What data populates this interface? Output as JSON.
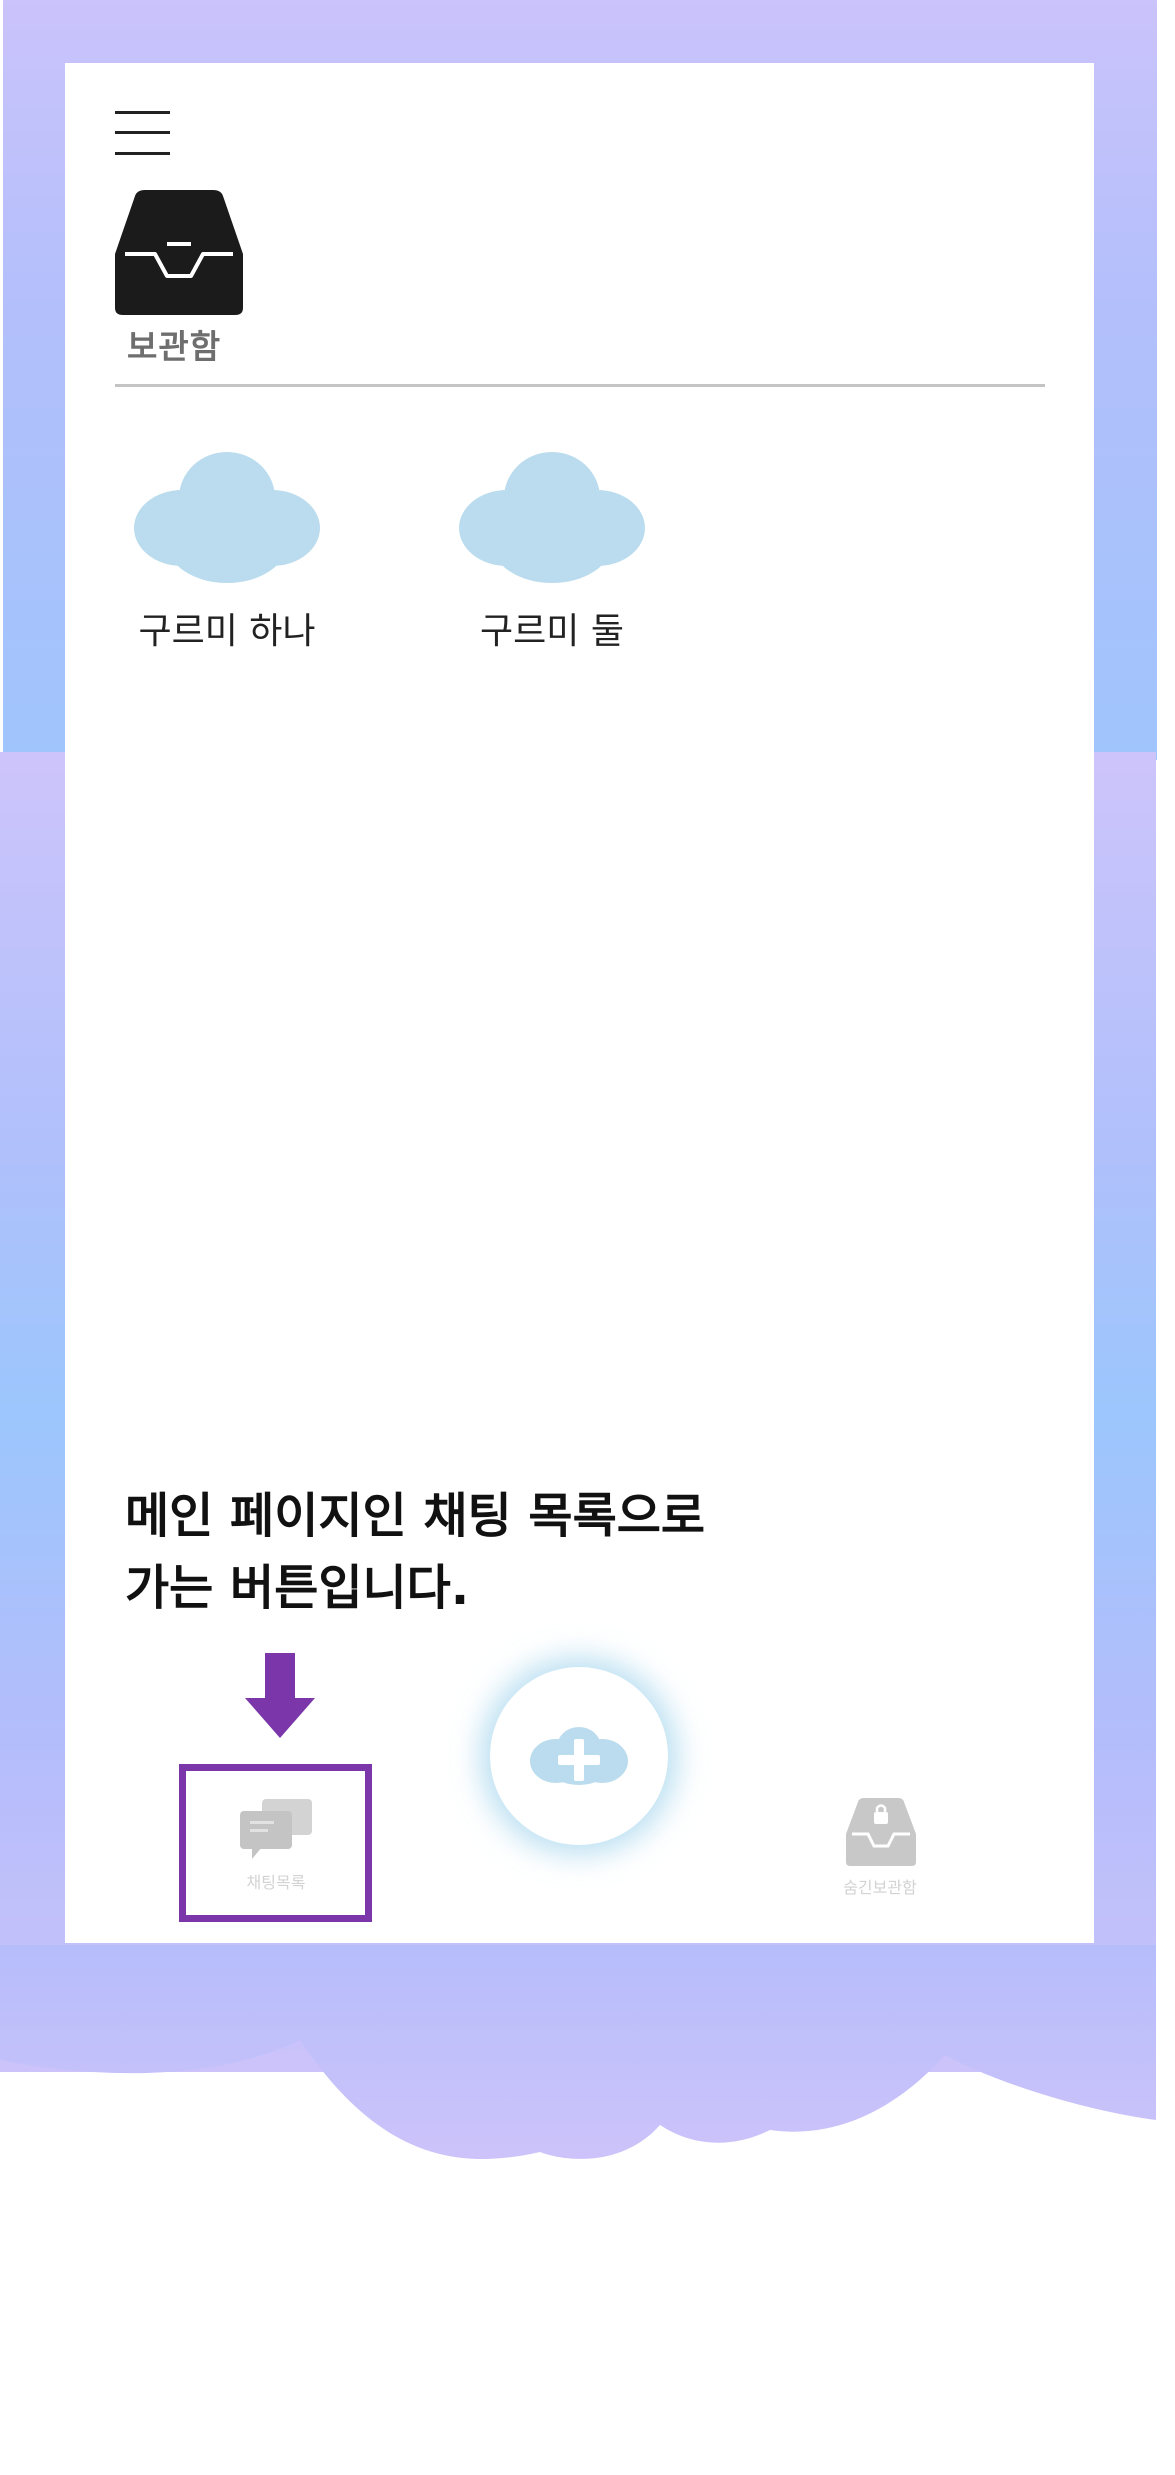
{
  "header": {
    "menu_icon": "hamburger-menu-icon",
    "storage_icon": "inbox-tray-icon",
    "title": "보관함"
  },
  "clouds": [
    {
      "label": "구르미 하나",
      "icon": "cloud-icon"
    },
    {
      "label": "구르미 둘",
      "icon": "cloud-icon"
    }
  ],
  "annotation": {
    "line1": "메인 페이지인 채팅 목록으로",
    "line2": "가는 버튼입니다."
  },
  "bottom_nav": {
    "chat_label": "채팅목록",
    "chat_icon": "chat-bubbles-icon",
    "add_icon": "plus-icon",
    "secret_label": "숨긴보관함",
    "secret_icon": "locked-tray-icon"
  },
  "colors": {
    "cloud": "#bbdcee",
    "highlight": "#7b37a9",
    "nav_icon": "#d3d3d3"
  }
}
